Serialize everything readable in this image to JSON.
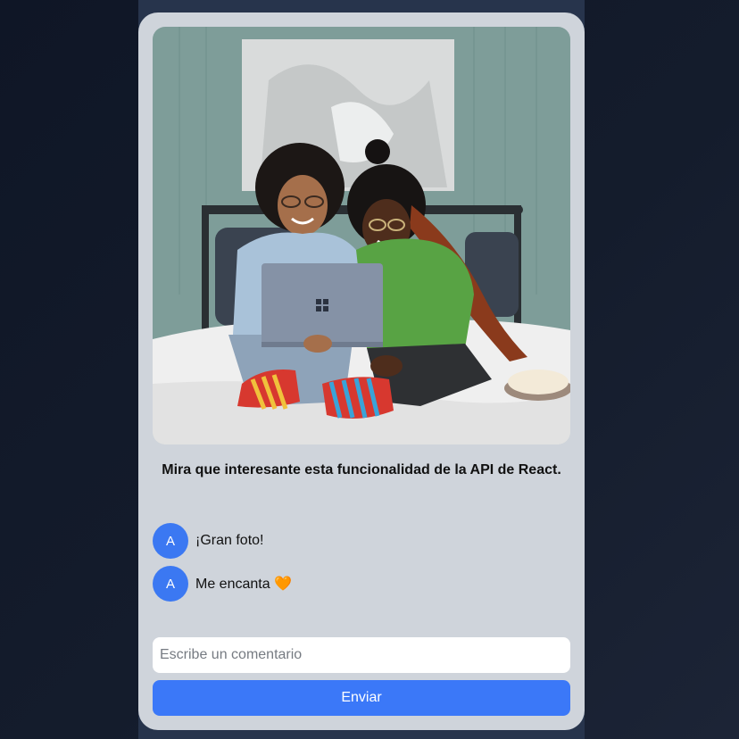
{
  "post": {
    "image_alt": "Two women smiling while looking at a laptop, sitting on a bed",
    "caption": "Mira que interesante esta funcionalidad de la API de React."
  },
  "comments": [
    {
      "avatar": "A",
      "text": "¡Gran foto!"
    },
    {
      "avatar": "A",
      "text": "Me encanta 🧡"
    }
  ],
  "form": {
    "placeholder": "Escribe un comentario",
    "value": "",
    "submit_label": "Enviar"
  },
  "colors": {
    "accent": "#3b78f8",
    "card": "#cfd4db",
    "page": "#141c2c"
  }
}
